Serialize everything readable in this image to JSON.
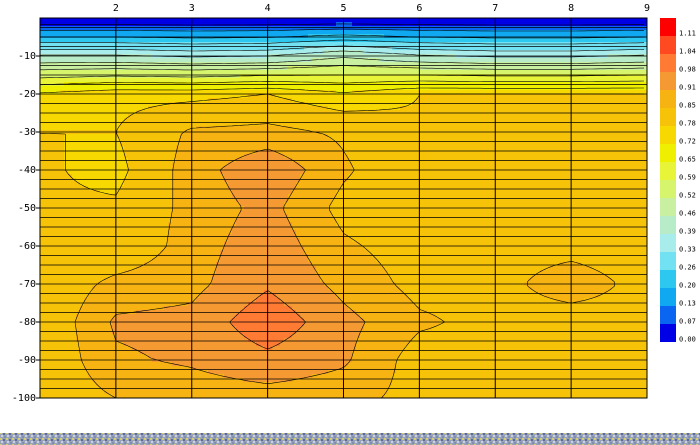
{
  "chart_data": {
    "type": "heatmap",
    "title": "",
    "xlabel": "",
    "ylabel": "",
    "xlim": [
      1,
      9
    ],
    "ylim": [
      -100,
      0
    ],
    "x_ticks": [
      "2",
      "3",
      "4",
      "5",
      "6",
      "7",
      "8",
      "9"
    ],
    "y_ticks": [
      "-10",
      "-20",
      "-30",
      "-40",
      "-50",
      "-60",
      "-70",
      "-80",
      "-90",
      "-100"
    ],
    "grid": true,
    "legend_position": "right",
    "colorbar": {
      "labels": [
        "1.11",
        "1.04",
        "0.98",
        "0.91",
        "0.85",
        "0.78",
        "0.72",
        "0.65",
        "0.59",
        "0.52",
        "0.46",
        "0.39",
        "0.33",
        "0.26",
        "0.20",
        "0.13",
        "0.07",
        "0.00"
      ],
      "colors": [
        "#ff0000",
        "#ff4a21",
        "#ff7a33",
        "#f59a33",
        "#f6b311",
        "#f7c309",
        "#f7d800",
        "#eef000",
        "#e8f438",
        "#d6f46c",
        "#c8f0a0",
        "#b8ecc8",
        "#a8ecec",
        "#72e2f2",
        "#2cc8f0",
        "#10a8f0",
        "#0a66f0",
        "#0000e6"
      ]
    },
    "x": [
      1,
      2,
      3,
      4,
      5,
      6,
      7,
      8,
      9
    ],
    "y": [
      0,
      -10,
      -20,
      -30,
      -40,
      -50,
      -60,
      -70,
      -80,
      -90,
      -100
    ],
    "z": [
      [
        0.0,
        0.0,
        0.0,
        0.0,
        0.0,
        0.0,
        0.0,
        0.0,
        0.0
      ],
      [
        0.4,
        0.4,
        0.38,
        0.39,
        0.45,
        0.4,
        0.38,
        0.38,
        0.4
      ],
      [
        0.73,
        0.76,
        0.76,
        0.78,
        0.73,
        0.78,
        0.78,
        0.78,
        0.78
      ],
      [
        0.78,
        0.78,
        0.86,
        0.87,
        0.84,
        0.79,
        0.79,
        0.79,
        0.84
      ],
      [
        0.79,
        0.76,
        0.88,
        0.96,
        0.86,
        0.79,
        0.78,
        0.79,
        0.79
      ],
      [
        0.79,
        0.79,
        0.87,
        0.93,
        0.83,
        0.8,
        0.79,
        0.8,
        0.8
      ],
      [
        0.79,
        0.79,
        0.88,
        0.95,
        0.86,
        0.82,
        0.83,
        0.83,
        0.82
      ],
      [
        0.79,
        0.87,
        0.89,
        0.97,
        0.89,
        0.83,
        0.83,
        0.88,
        0.83
      ],
      [
        0.79,
        0.92,
        0.93,
        1.03,
        0.93,
        0.86,
        0.83,
        0.82,
        0.83
      ],
      [
        0.79,
        0.9,
        0.92,
        0.96,
        0.92,
        0.82,
        0.83,
        0.83,
        0.83
      ],
      [
        0.8,
        0.85,
        0.87,
        0.88,
        0.87,
        0.83,
        0.84,
        0.84,
        0.84
      ]
    ]
  }
}
